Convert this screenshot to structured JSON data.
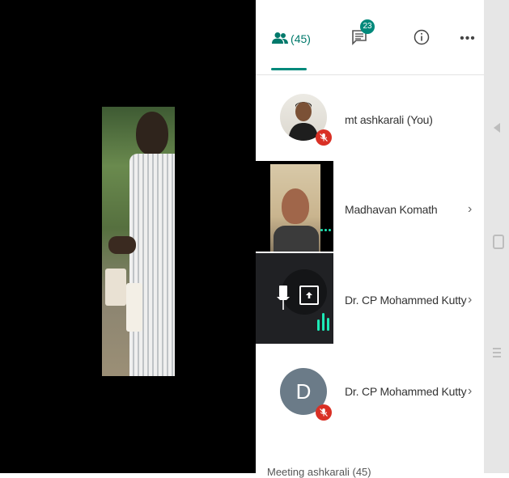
{
  "tabs": {
    "people": {
      "icon": "people-icon",
      "count_label": "(45)"
    },
    "chat": {
      "icon": "chat-icon",
      "badge": "23"
    },
    "info": {
      "icon": "info-icon"
    },
    "more": {
      "icon": "more-icon",
      "label": "•••"
    }
  },
  "participants": [
    {
      "name": "mt ashkarali (You)",
      "mic": "muted",
      "has_chevron": false
    },
    {
      "name": "Madhavan Komath",
      "mic": "active",
      "has_chevron": true,
      "chevron": "›"
    },
    {
      "name": "Dr. CP Mohammed Kutty",
      "mic": "speaking",
      "presenting": true,
      "has_chevron": true,
      "chevron": "›"
    },
    {
      "name": "Dr. CP Mohammed Kutty",
      "mic": "muted",
      "avatar_letter": "D",
      "has_chevron": true,
      "chevron": "›"
    }
  ],
  "bottom_label": "Meeting ashkarali (45)",
  "colors": {
    "accent": "#00897b",
    "muted_red": "#d93025",
    "speaking_green": "#1de9b6",
    "avatar_grey": "#6b7b88"
  }
}
